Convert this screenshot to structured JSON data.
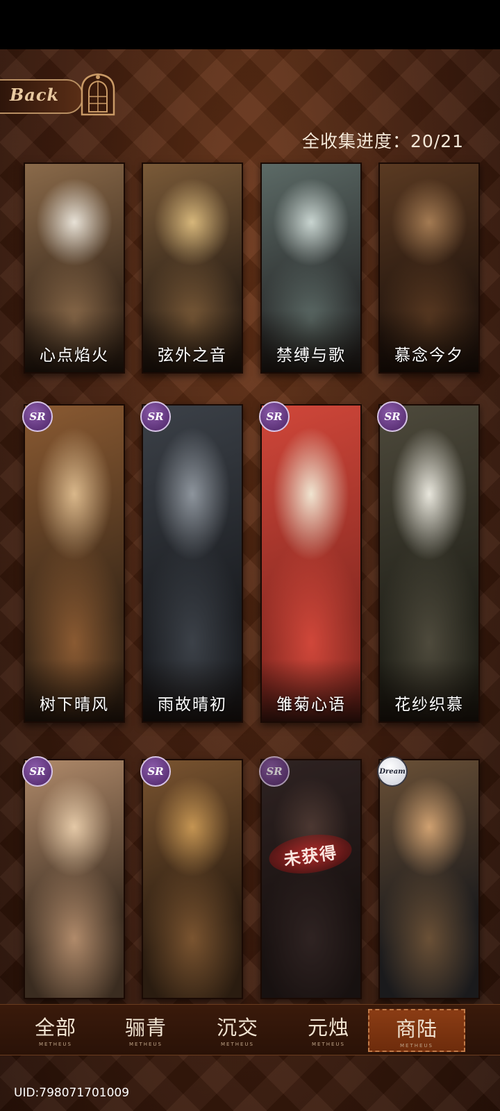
{
  "header": {
    "back_label": "Back",
    "progress_text": "全收集进度：20/21"
  },
  "cards": [
    {
      "title": "心点焰火",
      "badge": "",
      "locked": false,
      "colors": [
        "#3b2a1c",
        "#8a6a4a",
        "#e7e1d6"
      ]
    },
    {
      "title": "弦外之音",
      "badge": "",
      "locked": false,
      "colors": [
        "#2c2016",
        "#7a5a38",
        "#d6b67a"
      ]
    },
    {
      "title": "禁缚与歌",
      "badge": "",
      "locked": false,
      "colors": [
        "#2a2c2c",
        "#5c6a66",
        "#c8d4d0"
      ]
    },
    {
      "title": "慕念今夕",
      "badge": "",
      "locked": false,
      "colors": [
        "#24160e",
        "#5a3a22",
        "#a37a52"
      ]
    },
    {
      "title": "树下晴风",
      "badge": "SR",
      "locked": false,
      "colors": [
        "#3a2818",
        "#8a5a32",
        "#d9b78a"
      ]
    },
    {
      "title": "雨故晴初",
      "badge": "SR",
      "locked": false,
      "colors": [
        "#1a1c20",
        "#3c4148",
        "#8d949c"
      ]
    },
    {
      "title": "雏菊心语",
      "badge": "SR",
      "locked": false,
      "colors": [
        "#8a2a22",
        "#d0473a",
        "#f0e4d0"
      ]
    },
    {
      "title": "花纱织慕",
      "badge": "SR",
      "locked": false,
      "colors": [
        "#202018",
        "#4e4a3c",
        "#e8e6dc"
      ]
    },
    {
      "title": "",
      "badge": "SR",
      "locked": false,
      "colors": [
        "#3a2c20",
        "#b08a6a",
        "#e4c8a6"
      ]
    },
    {
      "title": "",
      "badge": "SR",
      "locked": false,
      "colors": [
        "#2a1c10",
        "#7a5430",
        "#c49452"
      ]
    },
    {
      "title": "",
      "badge": "SR",
      "locked": true,
      "stamp": "未获得",
      "colors": [
        "#1a1414",
        "#3e3030",
        "#6a5048"
      ]
    },
    {
      "title": "",
      "badge": "Dream",
      "locked": false,
      "colors": [
        "#1a1a1c",
        "#6a5036",
        "#cfa070"
      ]
    }
  ],
  "tabs": [
    {
      "label": "全部",
      "sub": "METHEUS",
      "active": false
    },
    {
      "label": "骊青",
      "sub": "METHEUS",
      "active": false
    },
    {
      "label": "沉交",
      "sub": "METHEUS",
      "active": false
    },
    {
      "label": "元烛",
      "sub": "METHEUS",
      "active": false
    },
    {
      "label": "商陆",
      "sub": "METHEUS",
      "active": true
    }
  ],
  "footer": {
    "uid": "UID:798071701009"
  }
}
